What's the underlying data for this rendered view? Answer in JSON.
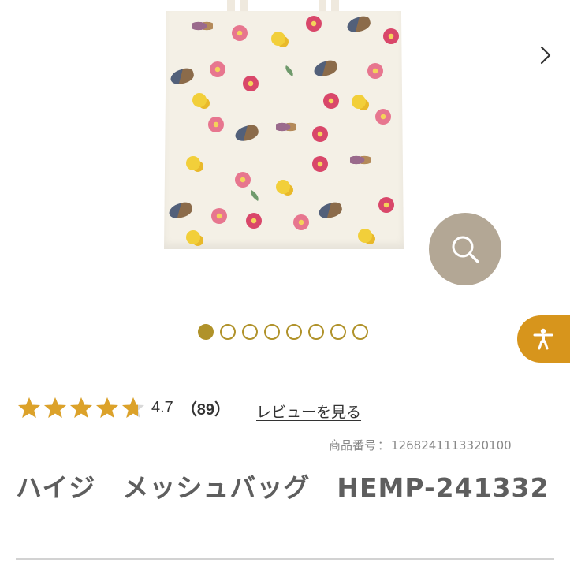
{
  "gallery": {
    "image_alt": "ハイジ メッシュバッグ",
    "slide_count": 8,
    "active_slide": 1,
    "zoom_icon": "search-icon",
    "next_icon": "chevron-right-icon"
  },
  "accessibility": {
    "icon": "accessibility-person-icon"
  },
  "rating": {
    "stars": 4.7,
    "value": "4.7",
    "count": "（89）",
    "review_link": "レビューを見る"
  },
  "product": {
    "code_label": "商品番号",
    "code_sep": "：",
    "code": "1268241113320100",
    "title": "ハイジ　メッシュバッグ　HEMP-241332"
  },
  "colors": {
    "accent": "#b0922a",
    "a11y": "#d7951c",
    "zoom": "#b3a795",
    "star": "#dca22a"
  }
}
